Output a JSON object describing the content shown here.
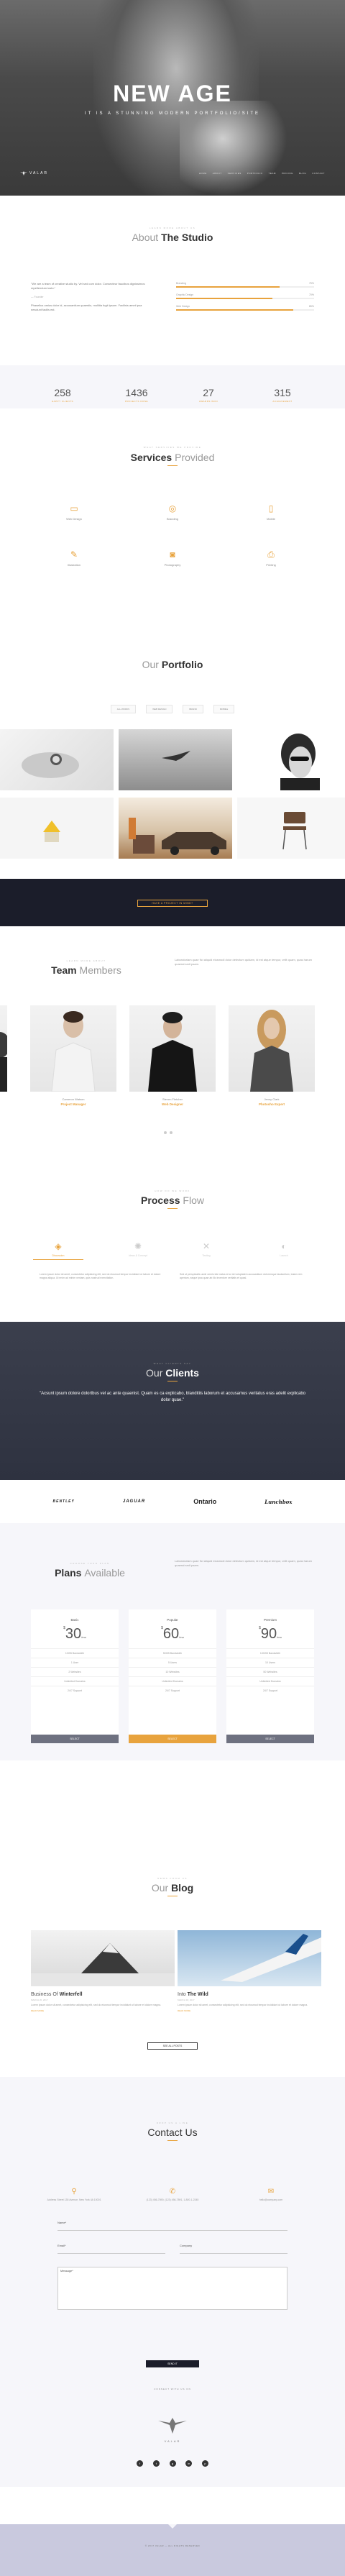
{
  "hero": {
    "title": "NEW AGE",
    "subtitle": "IT IS A STUNNING MODERN PORTFOLIO/SITE",
    "logo": "VALAR",
    "nav": [
      "HOME",
      "ABOUT",
      "SERVICES",
      "PORTFOLIO",
      "TEAM",
      "PRICING",
      "BLOG",
      "CONTACT"
    ]
  },
  "about": {
    "kicker": "LEARN MORE ABOUT US",
    "title_pre": "About",
    "title_bold": "The Studio",
    "quote": "\"We are a team of creative studio by. Vel sed cum dolor. Consecteur faucibus dignissimos repellendum iusto.\"",
    "author": "— Founder",
    "body": "Phasellus varius dolor id, accusantium quaestio, mollitia fugit ipsum. Facilisis amet ipsa nesciunt facilis est.",
    "skills": [
      {
        "name": "Branding",
        "value": "75%",
        "fill": 0.75
      },
      {
        "name": "Graphic Design",
        "value": "70%",
        "fill": 0.7
      },
      {
        "name": "Web Design",
        "value": "85%",
        "fill": 0.85
      }
    ]
  },
  "stats": [
    {
      "num": "258",
      "label": "HAPPY CLIENTS"
    },
    {
      "num": "1436",
      "label": "PROJECTS DONE"
    },
    {
      "num": "27",
      "label": "AWARDS WON"
    },
    {
      "num": "315",
      "label": "ACHIEVEMENT"
    }
  ],
  "services": {
    "kicker": "WHAT SERVICES WE PROVIDE",
    "title_bold": "Services",
    "title_light": "Provided",
    "items": [
      {
        "label": "Web Design",
        "icon": "▭"
      },
      {
        "label": "Branding",
        "icon": "◎"
      },
      {
        "label": "Mobile",
        "icon": "▯"
      },
      {
        "label": "Illustration",
        "icon": "✎"
      },
      {
        "label": "Photography",
        "icon": "◙"
      },
      {
        "label": "Printing",
        "icon": "⎙"
      }
    ]
  },
  "portfolio": {
    "title_light": "Our",
    "title_bold": "Portfolio",
    "filters": [
      "ALL WORKS",
      "WEB DESIGN",
      "BRAND",
      "MOBILE"
    ],
    "cta": "HAVE A PROJECT IN MIND?"
  },
  "team": {
    "kicker": "LEARN MORE ABOUT",
    "title_bold": "Team",
    "title_light": "Members",
    "intro": "Laboratoriam quae fici aliquid eiusmodi dolor delectum quidam, id est atque tempor, velit quam, quas harum quaerat sed ipsam.",
    "members": [
      {
        "name": "Cameron Watson",
        "role": "Project Manager"
      },
      {
        "name": "Steven Fletcher",
        "role": "Web Designer"
      },
      {
        "name": "Jenny Clark",
        "role": "Photosho Expert"
      }
    ]
  },
  "process": {
    "kicker": "HOW DO WE WORK",
    "title_bold": "Process",
    "title_light": "Flow",
    "steps": [
      {
        "label": "Discussion",
        "icon": "◈",
        "active": true
      },
      {
        "label": "Ideas & Concept",
        "icon": "✺",
        "active": false
      },
      {
        "label": "Testing",
        "icon": "✕",
        "active": false
      },
      {
        "label": "Launch",
        "icon": "◐",
        "active": false
      }
    ],
    "text1": "Lorem ipsum dolor sit amet, consectetur adipisicing elit, sed do eiusmod tempor incididunt ut labore et dolore magna aliqua. Ut enim ad minim veniam, quis nostrud exercitation.",
    "text2": "Sed ut perspiciatis unde omnis iste natus error sit voluptatem accusantium doloremque laudantium, totam rem aperiam, eaque ipsa quae ab illo inventore veritatis et quasi."
  },
  "clients": {
    "kicker": "WHAT CLIENTS SAY",
    "title_light": "Our",
    "title_bold": "Clients",
    "quote": "\"Acsunt ipsum dolore dolortbus vel ac ante quaenist. Quam es ca explicabo, blanditiis laborum et accusamus veritatus eras adelit explicabo dolor quae.\"",
    "logos": [
      "BENTLEY",
      "JAGUAR",
      "Ontario",
      "Lunchbox"
    ]
  },
  "plans": {
    "kicker": "CHOOSE YOUR PLAN",
    "title_bold": "Plans",
    "title_light": "Available",
    "intro": "Laboratoriam quae fici aliquid eiusmodi dolor delectum quidam, id est atque tempor, velit quam, quas harum quaerat sed ipsam.",
    "items": [
      {
        "name": "Basic",
        "price": "30",
        "cur": "$",
        "per": "/mo",
        "features": [
          "10GB Bandwidth",
          "1 User",
          "2 Websites",
          "Unlimited Domains",
          "24/7 Support"
        ],
        "button": "SELECT",
        "featured": false
      },
      {
        "name": "Popular",
        "price": "60",
        "cur": "$",
        "per": "/mo",
        "features": [
          "50GB Bandwidth",
          "5 Users",
          "10 Websites",
          "Unlimited Domains",
          "24/7 Support"
        ],
        "button": "SELECT",
        "featured": true
      },
      {
        "name": "Premium",
        "price": "90",
        "cur": "$",
        "per": "/mo",
        "features": [
          "100GB Bandwidth",
          "10 Users",
          "50 Websites",
          "Unlimited Domains",
          "24/7 Support"
        ],
        "button": "SELECT",
        "featured": false
      }
    ]
  },
  "blog": {
    "kicker": "NEWS FROM US",
    "title_light": "Our",
    "title_bold": "Blog",
    "posts": [
      {
        "pre": "Business Of",
        "bold": "Winterfell",
        "date": "MARCH 20, 2017",
        "excerpt": "Lorem ipsum dolor sit amet, consectetur adipisicing elit, sed do eiusmod tempor incididunt ut labore et dolore magna.",
        "more": "READ MORE"
      },
      {
        "pre": "Into",
        "bold": "The Wild",
        "date": "MARCH 18, 2017",
        "excerpt": "Lorem ipsum dolor sit amet, consectetur adipisicing elit, sed do eiusmod tempor incididunt ut labore et dolore magna.",
        "more": "READ MORE"
      }
    ],
    "all": "SEE ALL POSTS"
  },
  "contact": {
    "kicker": "DROP US A LINE",
    "title": "Contact Us",
    "info": [
      {
        "icon": "⚲",
        "text": "Address Street 135 Avenue, New York 4A 10001"
      },
      {
        "icon": "✆",
        "text": "(123) 456-7890, (123) 456-7891, 1-800-1-2345"
      },
      {
        "icon": "✉",
        "text": "hello@company.com"
      }
    ],
    "name_label": "Name*",
    "email_label": "Email*",
    "company_label": "Company",
    "message_label": "Message*",
    "submit": "SEND IT",
    "follow": "CONNECT WITH US ON",
    "logo": "VALAR",
    "social": [
      "f",
      "t",
      "g",
      "in",
      "p"
    ]
  },
  "footer": {
    "copy": "© 2017 VALAR — ALL RIGHTS RESERVED"
  }
}
